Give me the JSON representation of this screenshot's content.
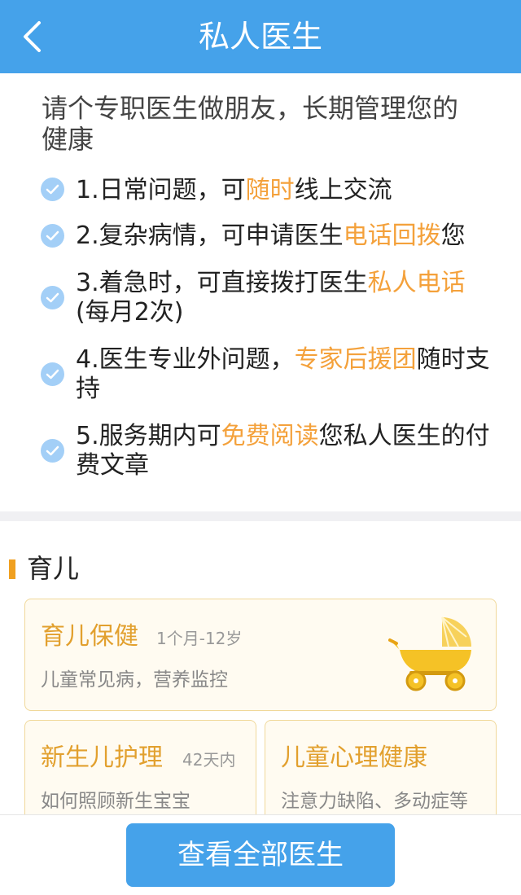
{
  "header": {
    "title": "私人医生"
  },
  "intro": {
    "title": "请个专职医生做朋友，长期管理您的健康",
    "features": [
      {
        "before": "1.日常问题，可",
        "highlight": "随时",
        "after": "线上交流"
      },
      {
        "before": "2.复杂病情，可申请医生",
        "highlight": "电话回拨",
        "after": "您"
      },
      {
        "before": "3.着急时，可直接拨打医生",
        "highlight": "私人电话",
        "after": "(每月2次)"
      },
      {
        "before": "4.医生专业外问题，",
        "highlight": "专家后援团",
        "after": "随时支持"
      },
      {
        "before": "5.服务期内可",
        "highlight": "免费阅读",
        "after": "您私人医生的付费文章"
      }
    ]
  },
  "section": {
    "title": "育儿",
    "cards": [
      {
        "title": "育儿保健",
        "age": "1个月-12岁",
        "desc": "儿童常见病，营养监控"
      },
      {
        "title": "新生儿护理",
        "age": "42天内",
        "desc": "如何照顾新生宝宝"
      },
      {
        "title": "儿童心理健康",
        "age": "",
        "desc": "注意力缺陷、多动症等"
      }
    ]
  },
  "cta": {
    "label": "查看全部医生"
  },
  "colors": {
    "primary": "#45a2ea",
    "highlight": "#f4a13b",
    "card_title": "#e2a02e",
    "check": "#a3cff7"
  }
}
